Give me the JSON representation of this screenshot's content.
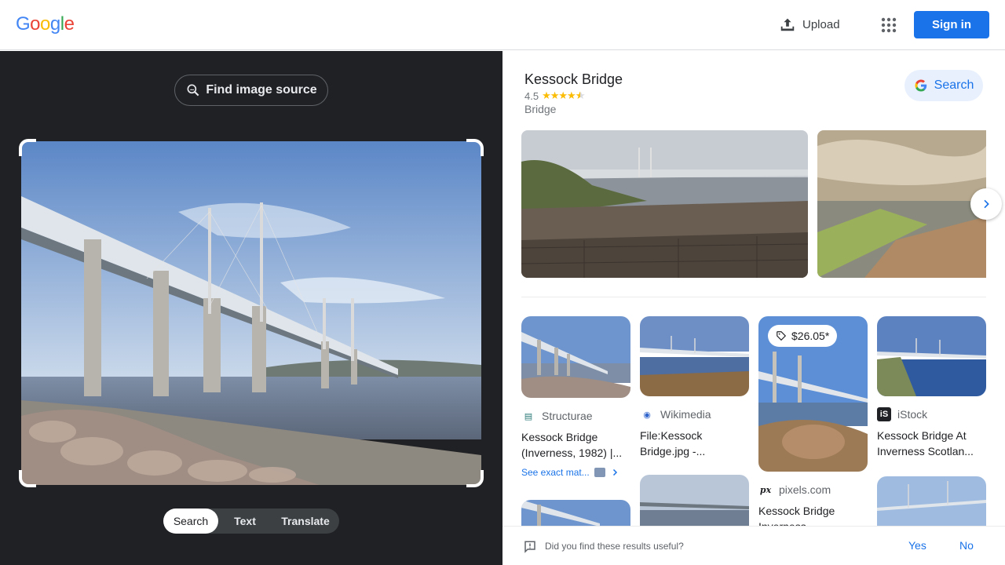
{
  "header": {
    "logo_letters": [
      "G",
      "o",
      "o",
      "g",
      "l",
      "e"
    ],
    "logo_colors": [
      "#4285F4",
      "#EA4335",
      "#FBBC05",
      "#4285F4",
      "#34A853",
      "#EA4335"
    ],
    "upload_label": "Upload",
    "apps_icon": "apps-grid-icon",
    "signin_label": "Sign in"
  },
  "left_panel": {
    "find_source_label": "Find image source",
    "modes": [
      {
        "label": "Search",
        "active": true
      },
      {
        "label": "Text",
        "active": false
      },
      {
        "label": "Translate",
        "active": false
      }
    ]
  },
  "knowledge_panel": {
    "title": "Kessock Bridge",
    "rating": "4.5",
    "stars": 4.5,
    "type": "Bridge",
    "search_label": "Search"
  },
  "results": [
    {
      "source": "Structurae",
      "title": "Kessock Bridge (Inverness, 1982) |...",
      "exact_match_label": "See exact mat..."
    },
    {
      "source": "Wikimedia",
      "title": "File:Kessock Bridge.jpg -..."
    },
    {
      "source": "pixels.com",
      "title": "Kessock Bridge Inverness",
      "price": "$26.05*"
    },
    {
      "source": "iStock",
      "title": "Kessock Bridge At Inverness Scotlan..."
    }
  ],
  "feedback": {
    "question": "Did you find these results useful?",
    "yes_label": "Yes",
    "no_label": "No"
  },
  "colors": {
    "accent": "#1a73e8",
    "dark_panel": "#202124",
    "star": "#fbbc04"
  }
}
